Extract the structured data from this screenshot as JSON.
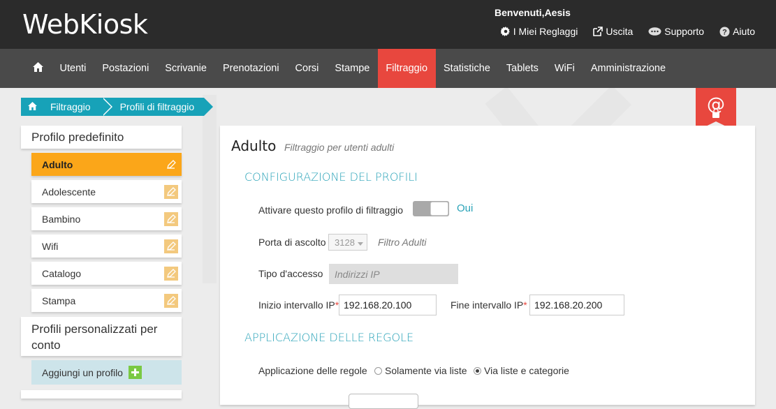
{
  "header": {
    "logo": "WebKiosk",
    "welcome": "Benvenuti,Aesis",
    "links": [
      {
        "icon": "gear-icon",
        "label": "I Miei Reglaggi"
      },
      {
        "icon": "external-link-icon",
        "label": "Uscita"
      },
      {
        "icon": "chat-icon",
        "label": "Supporto"
      },
      {
        "icon": "help-icon",
        "label": "Aiuto"
      }
    ]
  },
  "nav": {
    "home_icon": "home-icon",
    "items": [
      "Utenti",
      "Postazioni",
      "Scrivanie",
      "Prenotazioni",
      "Corsi",
      "Stampe",
      "Filtraggio",
      "Statistiche",
      "Tablets",
      "WiFi",
      "Amministrazione"
    ],
    "active": "Filtraggio",
    "active_color": "#e8473e"
  },
  "breadcrumb": {
    "home_icon": "home-icon",
    "items": [
      "Filtraggio",
      "Profili di filtraggio"
    ],
    "color": "#17a2b8"
  },
  "sidebar": {
    "default_heading": "Profilo predefinito",
    "default_profiles": [
      {
        "label": "Adulto",
        "active": true
      },
      {
        "label": "Adolescente"
      },
      {
        "label": "Bambino"
      },
      {
        "label": "Wifi"
      },
      {
        "label": "Catalogo"
      },
      {
        "label": "Stampa"
      }
    ],
    "custom_heading": "Profili personalizzati per conto",
    "add_label": "Aggiungi un profilo",
    "active_color": "#fba619"
  },
  "panel": {
    "title": "Adulto",
    "subtitle": "Filtraggio per utenti adulti",
    "section_config": "CONFIGURAZIONE DEL PROFILI",
    "activate_label": "Attivare questo profilo di filtraggio",
    "activate_value": "Oui",
    "port_label": "Porta di ascolto",
    "port_value": "3128",
    "port_hint": "Filtro Adulti",
    "access_label": "Tipo d'accesso",
    "access_value": "Indirizzi IP",
    "ip_start_label": "Inizio intervallo IP",
    "ip_start_value": "192.168.20.100",
    "ip_end_label": "Fine intervallo IP",
    "ip_end_value": "192.168.20.200",
    "section_rules": "APPLICAZIONE DELLE REGOLE",
    "rules_label": "Applicazione delle regole",
    "rules_options": [
      {
        "label": "Solamente via liste",
        "checked": false
      },
      {
        "label": "Via liste e categorie",
        "checked": true
      }
    ]
  }
}
